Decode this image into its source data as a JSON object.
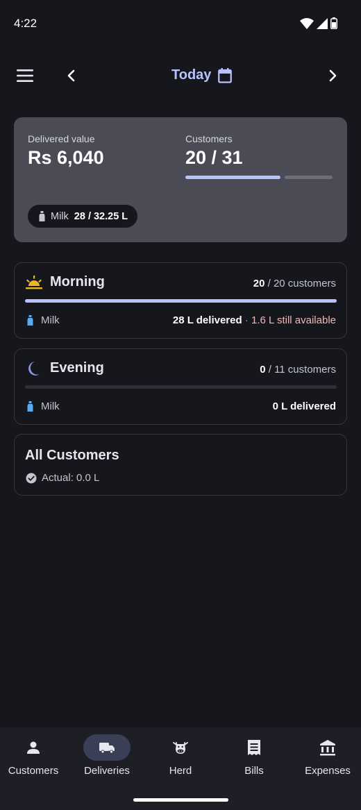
{
  "status_bar": {
    "time": "4:22"
  },
  "app_bar": {
    "title": "Today"
  },
  "summary": {
    "delivered_label": "Delivered value",
    "delivered_value": "Rs 6,040",
    "customers_label": "Customers",
    "customers_value": "20 / 31",
    "customers_progress": 0.645,
    "milk_label": "Milk",
    "milk_value": "28 / 32.25 L"
  },
  "shifts": [
    {
      "name": "Morning",
      "count_done": "20",
      "count_rest": " / 20 customers",
      "progress": 1.0,
      "product": "Milk",
      "delivered": "28 L delivered",
      "separator": " · ",
      "available": "1.6 L still available"
    },
    {
      "name": "Evening",
      "count_done": "0",
      "count_rest": " / 11 customers",
      "progress": 0.0,
      "product": "Milk",
      "delivered": "0 L delivered"
    }
  ],
  "all_customers": {
    "title": "All Customers",
    "actual": "Actual: 0.0 L"
  },
  "bottom_nav": {
    "items": [
      {
        "label": "Customers",
        "icon": "person-icon",
        "active": false
      },
      {
        "label": "Deliveries",
        "icon": "truck-icon",
        "active": true
      },
      {
        "label": "Herd",
        "icon": "cow-icon",
        "active": false
      },
      {
        "label": "Bills",
        "icon": "receipt-icon",
        "active": false
      },
      {
        "label": "Expenses",
        "icon": "bank-icon",
        "active": false
      }
    ]
  },
  "colors": {
    "accent": "#b7c3ff",
    "background": "#16171c",
    "card": "#4a4b55",
    "warning_text": "#f2b8b5",
    "morning_icon": "#f0b429",
    "evening_icon": "#8e95e6",
    "milk_icon": "#5aaaf0"
  }
}
